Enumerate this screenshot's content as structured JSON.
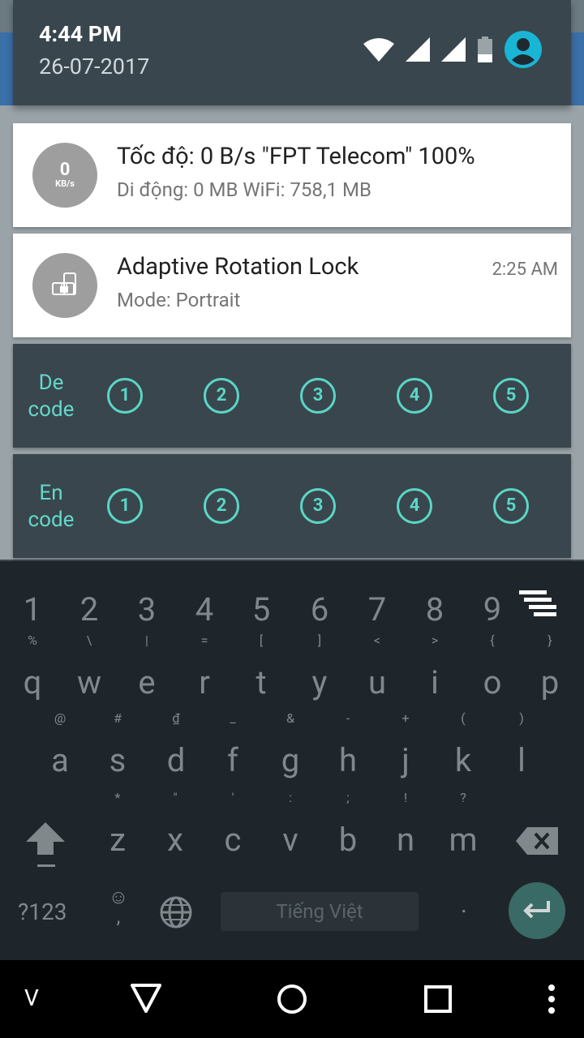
{
  "status": {
    "time": "4:44 PM",
    "date": "26-07-2017"
  },
  "notifications": [
    {
      "avatar_value": "0",
      "avatar_unit": "KB/s",
      "title": "Tốc độ: 0 B/s   \"FPT Telecom\" 100%",
      "subtitle": "Di động: 0 MB   WiFi: 758,1 MB"
    },
    {
      "title": "Adaptive Rotation Lock",
      "subtitle": "Mode: Portrait",
      "time": "2:25 AM"
    }
  ],
  "decode": {
    "label_line1": "De",
    "label_line2": "code",
    "buttons": [
      "1",
      "2",
      "3",
      "4",
      "5"
    ]
  },
  "encode": {
    "label_line1": "En",
    "label_line2": "code",
    "buttons": [
      "1",
      "2",
      "3",
      "4",
      "5"
    ]
  },
  "keyboard": {
    "numbers": [
      "1",
      "2",
      "3",
      "4",
      "5",
      "6",
      "7",
      "8",
      "9"
    ],
    "row1": [
      "q",
      "w",
      "e",
      "r",
      "t",
      "y",
      "u",
      "i",
      "o",
      "p"
    ],
    "row1_hints": [
      "%",
      "\\",
      "|",
      "=",
      "[",
      "]",
      "<",
      ">",
      "{",
      "}"
    ],
    "row2": [
      "a",
      "s",
      "d",
      "f",
      "g",
      "h",
      "j",
      "k",
      "l"
    ],
    "row2_hints": [
      "@",
      "#",
      "₫",
      "_",
      "&",
      "-",
      "+",
      "(",
      ")"
    ],
    "row3": [
      "z",
      "x",
      "c",
      "v",
      "b",
      "n",
      "m"
    ],
    "row3_hints": [
      "*",
      "\"",
      "'",
      ":",
      ";",
      "!",
      "?"
    ],
    "symbols_key": "?123",
    "emoji_top": "☺",
    "emoji_bottom": ",",
    "space_label": "Tiếng Việt",
    "period_key": "."
  },
  "navbar": {
    "left_label": "V"
  },
  "colors": {
    "accent": "#5ad6c6",
    "header_bg": "#39464d",
    "keyboard_bg": "#1f262b"
  }
}
